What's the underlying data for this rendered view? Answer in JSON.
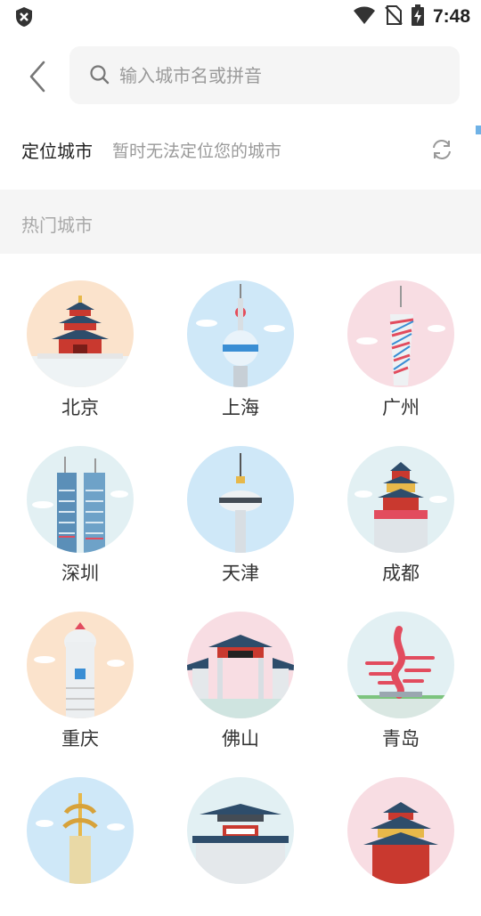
{
  "status_bar": {
    "time": "7:48",
    "icons": [
      "shield-icon",
      "wifi-icon",
      "no-sim-icon",
      "battery-charging-icon"
    ]
  },
  "header": {
    "back_icon": "chevron-left-icon",
    "search": {
      "placeholder": "输入城市名或拼音",
      "value": ""
    }
  },
  "locate": {
    "title": "定位城市",
    "status": "暂时无法定位您的城市",
    "refresh_icon": "refresh-icon"
  },
  "hot": {
    "title": "热门城市",
    "cities": [
      {
        "name": "北京",
        "bg": "#fbe3cc"
      },
      {
        "name": "上海",
        "bg": "#cfe8f8"
      },
      {
        "name": "广州",
        "bg": "#f8dde3"
      },
      {
        "name": "深圳",
        "bg": "#e2f0f3"
      },
      {
        "name": "天津",
        "bg": "#cfe8f8"
      },
      {
        "name": "成都",
        "bg": "#e2f0f3"
      },
      {
        "name": "重庆",
        "bg": "#fbe3cc"
      },
      {
        "name": "佛山",
        "bg": "#f8dde3"
      },
      {
        "name": "青岛",
        "bg": "#e2f0f3"
      },
      {
        "name": "",
        "bg": "#cfe8f8"
      },
      {
        "name": "",
        "bg": "#e2f0f3"
      },
      {
        "name": "",
        "bg": "#f8dde3"
      }
    ]
  },
  "colors": {
    "accent": "#6fb2e6",
    "placeholder": "#9a9a9a",
    "section_bg": "#f5f5f5"
  }
}
